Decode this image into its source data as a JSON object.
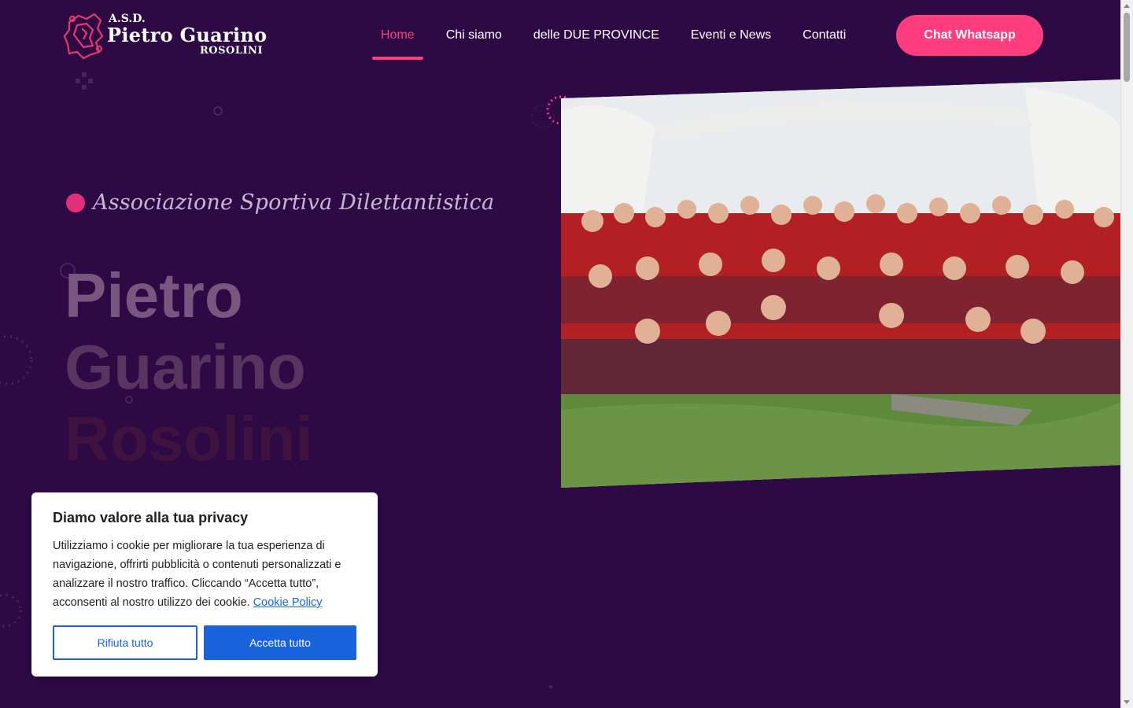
{
  "logo": {
    "asd": "A.S.D.",
    "name": "Pietro Guarino",
    "city": "ROSOLINI"
  },
  "nav": {
    "items": [
      {
        "label": "Home",
        "active": true
      },
      {
        "label": "Chi siamo",
        "active": false
      },
      {
        "label": "delle DUE PROVINCE",
        "active": false
      },
      {
        "label": "Eventi e News",
        "active": false
      },
      {
        "label": "Contatti",
        "active": false
      }
    ],
    "cta_label": "Chat Whatsapp"
  },
  "hero": {
    "tagline": "Associazione Sportiva Dilettantistica",
    "title_line_1": "Pietro",
    "title_line_2": "Guarino",
    "title_line_3": "Rosolini"
  },
  "cookie": {
    "title": "Diamo valore alla tua privacy",
    "text": "Utilizziamo i cookie per migliorare la tua esperienza di navigazione, offrirti pubblicità o contenuti personalizzati e analizzare il nostro traffico. Cliccando “Accetta tutto”, acconsenti al nostro utilizzo dei cookie.",
    "link": "Cookie Policy",
    "reject_label": "Rifiuta tutto",
    "accept_label": "Accetta tutto"
  },
  "colors": {
    "background": "#2e0a45",
    "accent": "#ff3d7f",
    "cookie_button": "#1863dc"
  }
}
